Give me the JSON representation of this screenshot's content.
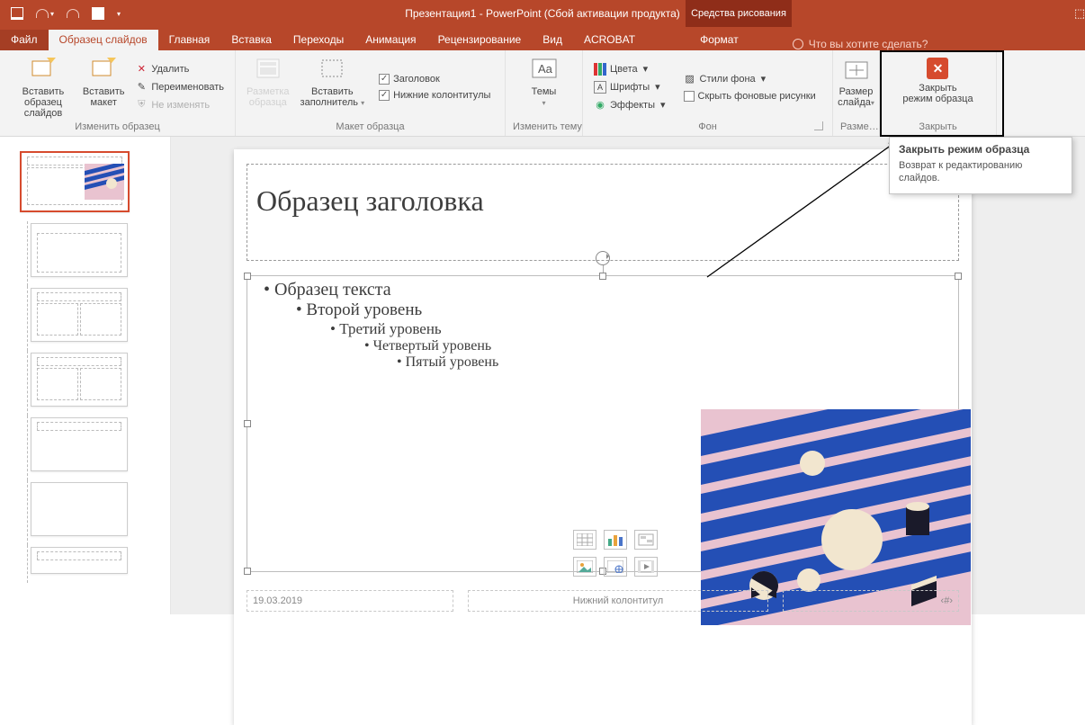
{
  "titlebar": {
    "title": "Презентация1 - PowerPoint (Сбой активации продукта)",
    "context_tab": "Средства рисования"
  },
  "tabs": {
    "file": "Файл",
    "master": "Образец слайдов",
    "home": "Главная",
    "insert": "Вставка",
    "transitions": "Переходы",
    "animation": "Анимация",
    "review": "Рецензирование",
    "view": "Вид",
    "acrobat": "ACROBAT",
    "format": "Формат",
    "tell_me": "Что вы хотите сделать?"
  },
  "ribbon": {
    "g1": {
      "insert_master": "Вставить\nобразец слайдов",
      "insert_layout": "Вставить\nмакет",
      "delete": "Удалить",
      "rename": "Переименовать",
      "preserve": "Не изменять",
      "label": "Изменить образец"
    },
    "g2": {
      "master_layout": "Разметка\nобразца",
      "insert_placeholder": "Вставить\nзаполнитель",
      "title_chk": "Заголовок",
      "footers_chk": "Нижние колонтитулы",
      "label": "Макет образца"
    },
    "g3": {
      "themes": "Темы",
      "label": "Изменить тему"
    },
    "g4": {
      "colors": "Цвета",
      "fonts": "Шрифты",
      "effects": "Эффекты",
      "bg_styles": "Стили фона",
      "hide_bg": "Скрыть фоновые рисунки",
      "label": "Фон"
    },
    "g5": {
      "slide_size": "Размер\nслайда",
      "label": "Разме…"
    },
    "g6": {
      "close": "Закрыть\nрежим образца",
      "label": "Закрыть"
    }
  },
  "tooltip": {
    "title": "Закрыть режим образца",
    "body": "Возврат к редактированию слайдов."
  },
  "slide": {
    "title": "Образец заголовка",
    "l1": "Образец текста",
    "l2": "Второй уровень",
    "l3": "Третий уровень",
    "l4": "Четвертый уровень",
    "l5": "Пятый уровень",
    "date": "19.03.2019",
    "footer": "Нижний колонтитул",
    "pagenum": "‹#›"
  },
  "thumbs": {
    "caption": "Образец заголовка"
  }
}
